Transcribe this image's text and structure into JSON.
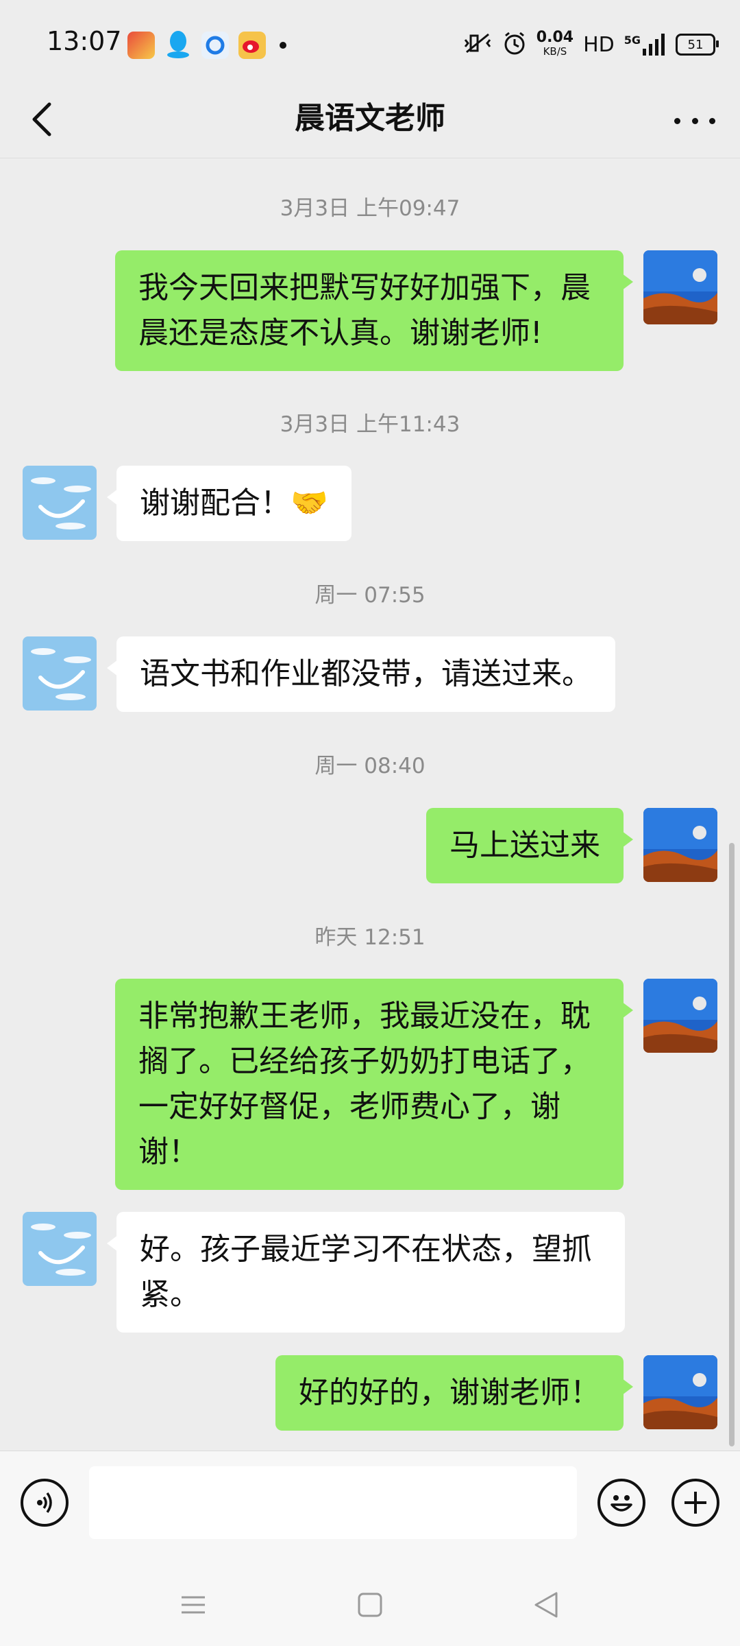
{
  "status_bar": {
    "time": "13:07",
    "net_speed": "0.04",
    "net_unit": "KB/S",
    "hd": "HD",
    "signal": "5G",
    "battery": "51"
  },
  "header": {
    "title": "晨语文老师"
  },
  "messages": [
    {
      "timestamp": "3月3日 上午09:47"
    },
    {
      "text": "我今天回来把默写好好加强下，晨晨还是态度不认真。谢谢老师!"
    },
    {
      "timestamp": "3月3日 上午11:43"
    },
    {
      "text": "谢谢配合！🤝"
    },
    {
      "timestamp": "周一 07:55"
    },
    {
      "text": "语文书和作业都没带，请送过来。"
    },
    {
      "timestamp": "周一 08:40"
    },
    {
      "text": "马上送过来"
    },
    {
      "timestamp": "昨天 12:51"
    },
    {
      "text": "非常抱歉王老师，我最近没在，耽搁了。已经给孩子奶奶打电话了，一定好好督促，老师费心了，谢谢！"
    },
    {
      "text": "好。孩子最近学习不在状态，望抓紧。"
    },
    {
      "text": "好的好的，谢谢老师！"
    }
  ],
  "input": {
    "value": ""
  },
  "icons": {
    "voice": "voice-icon",
    "emoji": "emoji-icon",
    "plus": "plus-icon",
    "back": "back-arrow-icon",
    "more": "more-icon"
  },
  "colors": {
    "sent_bubble": "#95ec69",
    "received_bubble": "#ffffff",
    "background": "#ededed"
  }
}
